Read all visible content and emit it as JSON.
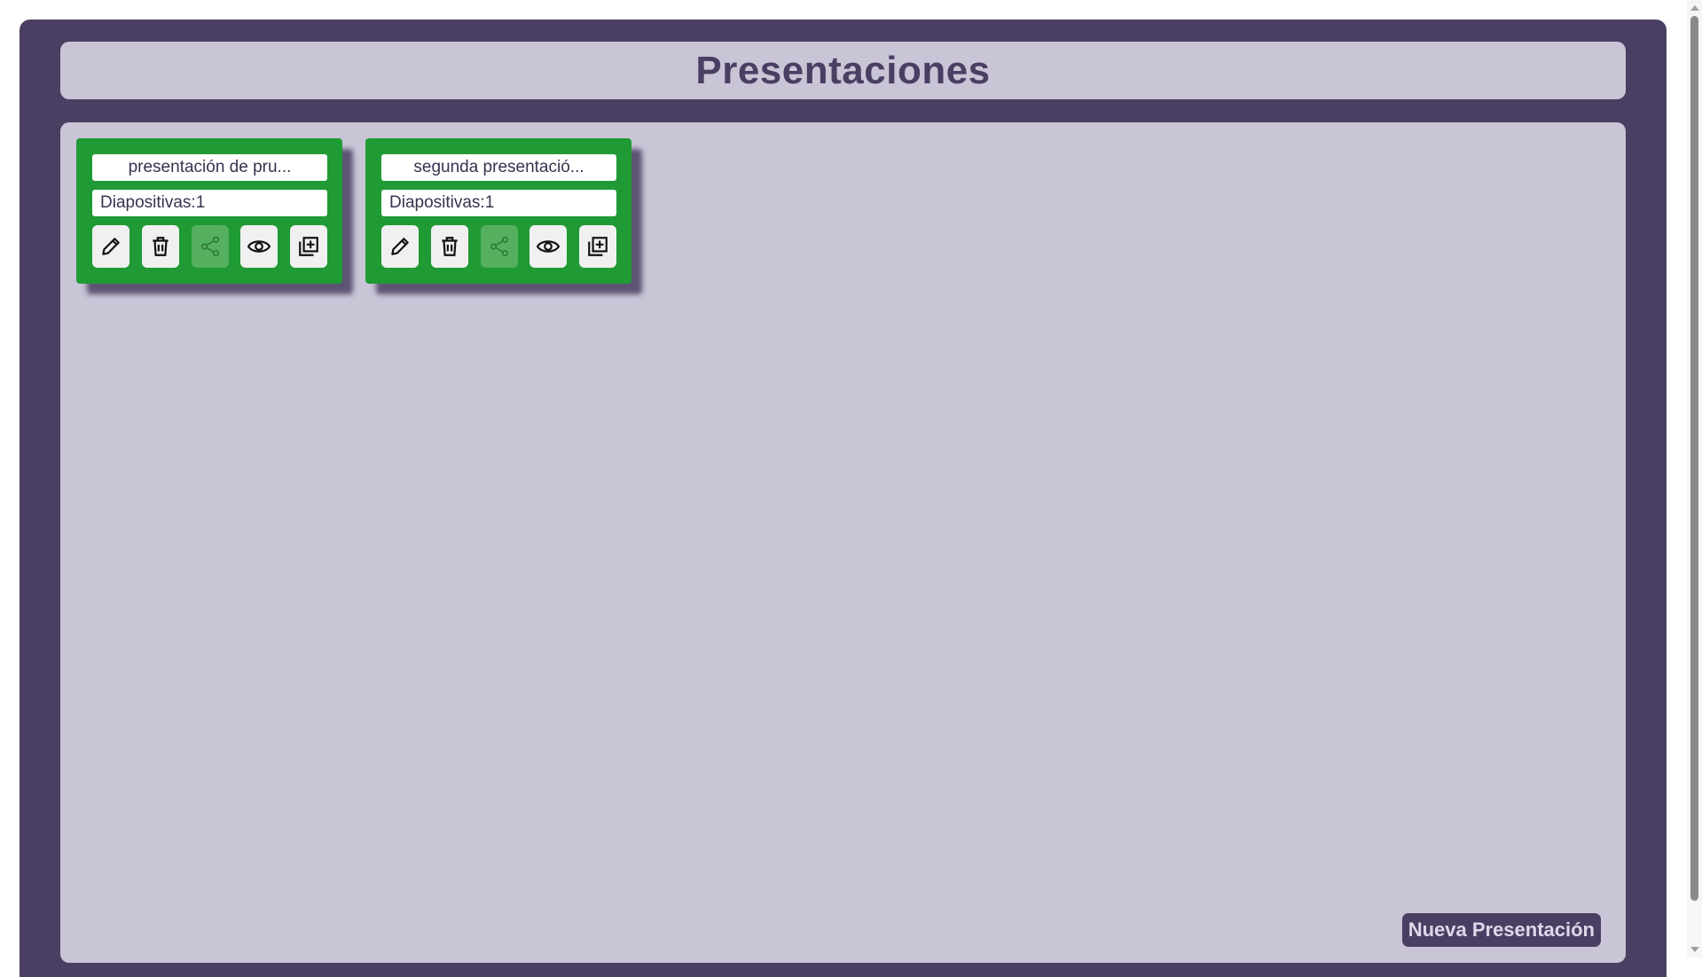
{
  "header": {
    "title": "Presentaciones"
  },
  "presentations": [
    {
      "title": "presentación de pru...",
      "slides_label": "Diapositivas:1",
      "actions": [
        "pencil-icon",
        "trash-icon",
        "share-icon",
        "eye-icon",
        "duplicate-icon"
      ]
    },
    {
      "title": "segunda presentació...",
      "slides_label": "Diapositivas:1",
      "actions": [
        "pencil-icon",
        "trash-icon",
        "share-icon",
        "eye-icon",
        "duplicate-icon"
      ]
    }
  ],
  "new_button": {
    "label": "Nueva Presentación"
  },
  "colors": {
    "frame": "#4a3f63",
    "panel": "#c9c5d7",
    "card": "#1f9a34",
    "share_disabled": "#55b060"
  }
}
